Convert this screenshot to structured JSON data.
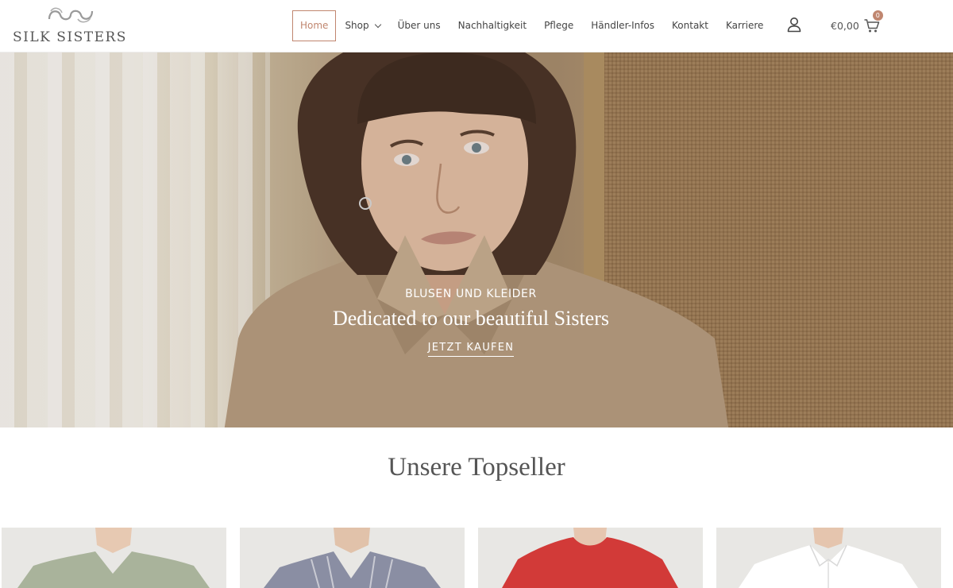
{
  "brand": {
    "name": "SILK SISTERS"
  },
  "nav": {
    "items": [
      {
        "label": "Home",
        "active": true
      },
      {
        "label": "Shop",
        "has_dropdown": true
      },
      {
        "label": "Über uns"
      },
      {
        "label": "Nachhaltigkeit"
      },
      {
        "label": "Pflege"
      },
      {
        "label": "Händler-Infos"
      },
      {
        "label": "Kontakt"
      },
      {
        "label": "Karriere"
      }
    ],
    "account_icon": "user-icon",
    "cart": {
      "total": "€0,00",
      "count": "0",
      "icon": "shopping-cart-icon"
    }
  },
  "hero": {
    "eyebrow": "BLUSEN UND KLEIDER",
    "title": "Dedicated to our beautiful Sisters",
    "cta": "JETZT KAUFEN"
  },
  "topseller": {
    "title": "Unsere Topseller",
    "products": [
      {
        "garment_color": "#a9b39b"
      },
      {
        "garment_color": "#8a8ea3"
      },
      {
        "garment_color": "#d23a38"
      },
      {
        "garment_color": "#ffffff"
      }
    ]
  },
  "colors": {
    "accent": "#c0866f",
    "text": "#444444",
    "hero_text": "#ffffff"
  }
}
